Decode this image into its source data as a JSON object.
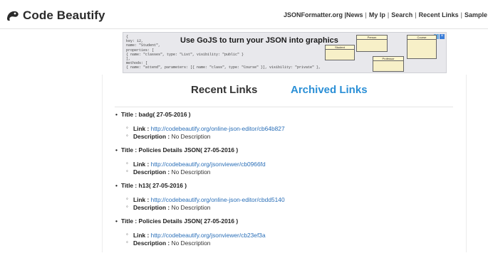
{
  "header": {
    "logo_text": "Code Beautify",
    "nav": [
      {
        "label": "JSONFormatter.org |News"
      },
      {
        "label": "My Ip"
      },
      {
        "label": "Search"
      },
      {
        "label": "Recent Links"
      },
      {
        "label": "Sample"
      }
    ]
  },
  "ad": {
    "headline": "Use GoJS to turn your JSON into graphics",
    "code_lines": [
      "{",
      "  key: 12,",
      "  name: \"Student\",",
      "  properties: [",
      "    { name: \"classes\", type: \"List\", visibility: \"public\" }",
      "  ],",
      "  methods: [",
      "    { name: \"attend\", parameters: [{ name: \"class\", type: \"Course\" }], visibility: \"private\" },"
    ],
    "uml_boxes": [
      "Person",
      "Student",
      "Course",
      "Professor"
    ]
  },
  "tabs": {
    "recent": "Recent Links",
    "archived": "Archived Links"
  },
  "labels": {
    "title": "Title :",
    "link": "Link :",
    "description": "Description :"
  },
  "entries": [
    {
      "title": "badg( 27-05-2016 )",
      "link": "http://codebeautify.org/online-json-editor/cb64b827",
      "description": "No Description"
    },
    {
      "title": "Policies Details JSON( 27-05-2016 )",
      "link": "http://codebeautify.org/jsonviewer/cb0966fd",
      "description": "No Description"
    },
    {
      "title": "h13( 27-05-2016 )",
      "link": "http://codebeautify.org/online-json-editor/cbdd5140",
      "description": "No Description"
    },
    {
      "title": "Policies Details JSON( 27-05-2016 )",
      "link": "http://codebeautify.org/jsonviewer/cb23ef3a",
      "description": "No Description"
    }
  ]
}
